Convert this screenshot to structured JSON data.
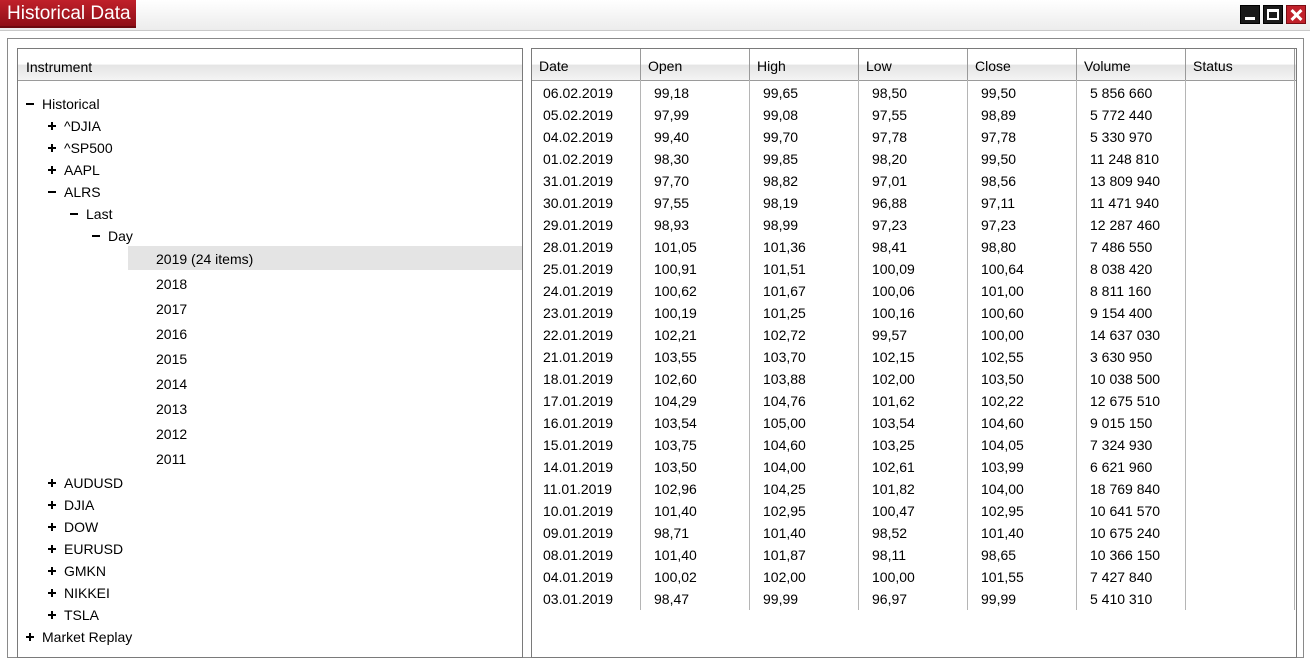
{
  "window": {
    "title": "Historical Data"
  },
  "tree": {
    "header": "Instrument",
    "rows": [
      {
        "label": "Historical",
        "toggle": "minus",
        "level": 0
      },
      {
        "label": "^DJIA",
        "toggle": "plus",
        "level": 1
      },
      {
        "label": "^SP500",
        "toggle": "plus",
        "level": 1
      },
      {
        "label": "AAPL",
        "toggle": "plus",
        "level": 1
      },
      {
        "label": "ALRS",
        "toggle": "minus",
        "level": 1
      },
      {
        "label": "Last",
        "toggle": "minus",
        "level": 2
      },
      {
        "label": "Day",
        "toggle": "minus",
        "level": 3
      },
      {
        "label": "2019 (24 items)",
        "toggle": "none",
        "level": 4,
        "selected": true
      },
      {
        "label": "2018",
        "toggle": "none",
        "level": 4
      },
      {
        "label": "2017",
        "toggle": "none",
        "level": 4
      },
      {
        "label": "2016",
        "toggle": "none",
        "level": 4
      },
      {
        "label": "2015",
        "toggle": "none",
        "level": 4
      },
      {
        "label": "2014",
        "toggle": "none",
        "level": 4
      },
      {
        "label": "2013",
        "toggle": "none",
        "level": 4
      },
      {
        "label": "2012",
        "toggle": "none",
        "level": 4
      },
      {
        "label": "2011",
        "toggle": "none",
        "level": 4
      },
      {
        "label": "AUDUSD",
        "toggle": "plus",
        "level": 1
      },
      {
        "label": "DJIA",
        "toggle": "plus",
        "level": 1
      },
      {
        "label": "DOW",
        "toggle": "plus",
        "level": 1
      },
      {
        "label": "EURUSD",
        "toggle": "plus",
        "level": 1
      },
      {
        "label": "GMKN",
        "toggle": "plus",
        "level": 1
      },
      {
        "label": "NIKKEI",
        "toggle": "plus",
        "level": 1
      },
      {
        "label": "TSLA",
        "toggle": "plus",
        "level": 1
      },
      {
        "label": "Market Replay",
        "toggle": "plus",
        "level": 0
      }
    ]
  },
  "table": {
    "columns": [
      "Date",
      "Open",
      "High",
      "Low",
      "Close",
      "Volume",
      "Status"
    ],
    "rows": [
      [
        "06.02.2019",
        "99,18",
        "99,65",
        "98,50",
        "99,50",
        "5 856 660",
        ""
      ],
      [
        "05.02.2019",
        "97,99",
        "99,08",
        "97,55",
        "98,89",
        "5 772 440",
        ""
      ],
      [
        "04.02.2019",
        "99,40",
        "99,70",
        "97,78",
        "97,78",
        "5 330 970",
        ""
      ],
      [
        "01.02.2019",
        "98,30",
        "99,85",
        "98,20",
        "99,50",
        "11 248 810",
        ""
      ],
      [
        "31.01.2019",
        "97,70",
        "98,82",
        "97,01",
        "98,56",
        "13 809 940",
        ""
      ],
      [
        "30.01.2019",
        "97,55",
        "98,19",
        "96,88",
        "97,11",
        "11 471 940",
        ""
      ],
      [
        "29.01.2019",
        "98,93",
        "98,99",
        "97,23",
        "97,23",
        "12 287 460",
        ""
      ],
      [
        "28.01.2019",
        "101,05",
        "101,36",
        "98,41",
        "98,80",
        "7 486 550",
        ""
      ],
      [
        "25.01.2019",
        "100,91",
        "101,51",
        "100,09",
        "100,64",
        "8 038 420",
        ""
      ],
      [
        "24.01.2019",
        "100,62",
        "101,67",
        "100,06",
        "101,00",
        "8 811 160",
        ""
      ],
      [
        "23.01.2019",
        "100,19",
        "101,25",
        "100,16",
        "100,60",
        "9 154 400",
        ""
      ],
      [
        "22.01.2019",
        "102,21",
        "102,72",
        "99,57",
        "100,00",
        "14 637 030",
        ""
      ],
      [
        "21.01.2019",
        "103,55",
        "103,70",
        "102,15",
        "102,55",
        "3 630 950",
        ""
      ],
      [
        "18.01.2019",
        "102,60",
        "103,88",
        "102,00",
        "103,50",
        "10 038 500",
        ""
      ],
      [
        "17.01.2019",
        "104,29",
        "104,76",
        "101,62",
        "102,22",
        "12 675 510",
        ""
      ],
      [
        "16.01.2019",
        "103,54",
        "105,00",
        "103,54",
        "104,60",
        "9 015 150",
        ""
      ],
      [
        "15.01.2019",
        "103,75",
        "104,60",
        "103,25",
        "104,05",
        "7 324 930",
        ""
      ],
      [
        "14.01.2019",
        "103,50",
        "104,00",
        "102,61",
        "103,99",
        "6 621 960",
        ""
      ],
      [
        "11.01.2019",
        "102,96",
        "104,25",
        "101,82",
        "104,00",
        "18 769 840",
        ""
      ],
      [
        "10.01.2019",
        "101,40",
        "102,95",
        "100,47",
        "102,95",
        "10 641 570",
        ""
      ],
      [
        "09.01.2019",
        "98,71",
        "101,40",
        "98,52",
        "101,40",
        "10 675 240",
        ""
      ],
      [
        "08.01.2019",
        "101,40",
        "101,87",
        "98,11",
        "98,65",
        "10 366 150",
        ""
      ],
      [
        "04.01.2019",
        "100,02",
        "102,00",
        "100,00",
        "101,55",
        "7 427 840",
        ""
      ],
      [
        "03.01.2019",
        "98,47",
        "99,99",
        "96,97",
        "99,99",
        "5 410 310",
        ""
      ]
    ]
  },
  "colors": {
    "title_accent": "#b01822",
    "selection": "#e4e4e4",
    "border": "#7a7a7a"
  }
}
